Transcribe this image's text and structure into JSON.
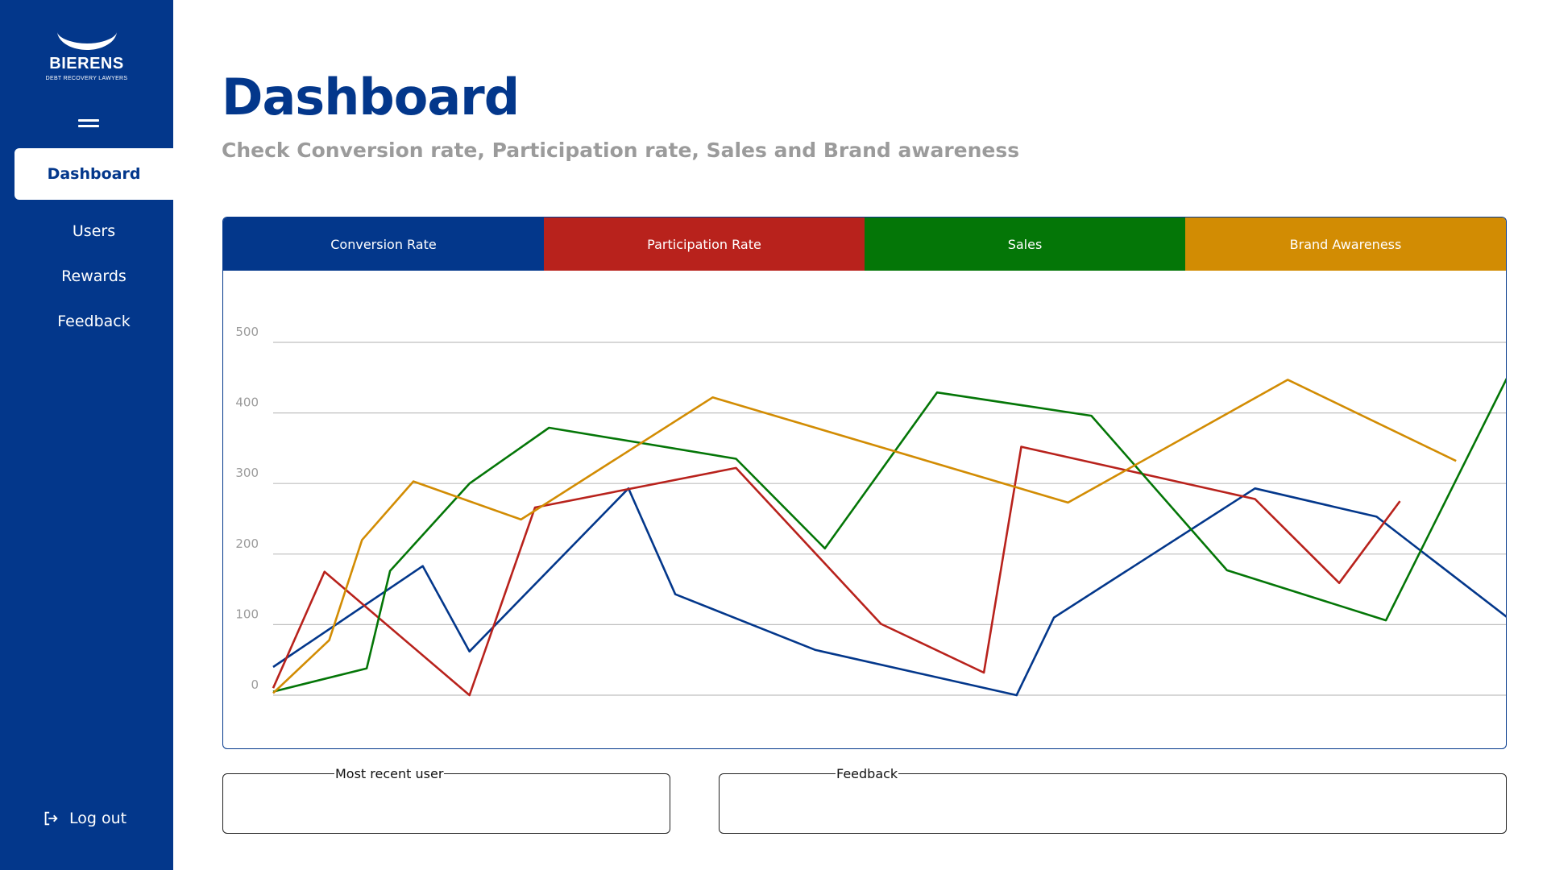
{
  "brand": {
    "name": "BIERENS",
    "tagline": "DEBT RECOVERY LAWYERS"
  },
  "sidebar": {
    "items": [
      {
        "label": "Dashboard",
        "active": true
      },
      {
        "label": "Users"
      },
      {
        "label": "Rewards"
      },
      {
        "label": "Feedback"
      }
    ],
    "logout_label": "Log out"
  },
  "header": {
    "title": "Dashboard",
    "subtitle": "Check Conversion rate, Participation rate, Sales and Brand awareness"
  },
  "tabs": [
    {
      "label": "Conversion Rate",
      "color": "#03378b"
    },
    {
      "label": "Participation Rate",
      "color": "#b8221c"
    },
    {
      "label": "Sales",
      "color": "#047607"
    },
    {
      "label": "Brand Awareness",
      "color": "#d28c03"
    }
  ],
  "colors": {
    "primary": "#03378b",
    "gridline": "#bfbfbf",
    "tick_text": "#9b9b9b"
  },
  "chart_data": {
    "type": "line",
    "y_ticks": [
      "500",
      "400",
      "300",
      "200",
      "100",
      "0"
    ],
    "ylim": [
      0,
      500
    ],
    "grid": true,
    "x": [
      0,
      1,
      2,
      3,
      4,
      5,
      6,
      7,
      8,
      9,
      10,
      11,
      12,
      13,
      14,
      15,
      16,
      17,
      18,
      19,
      20,
      21,
      22
    ],
    "series": [
      {
        "color": "#03378b",
        "points": [
          [
            0,
            40
          ],
          [
            3.2,
            183
          ],
          [
            4.2,
            62
          ],
          [
            7.6,
            293
          ],
          [
            8.6,
            143
          ],
          [
            11.6,
            64
          ],
          [
            15.9,
            0
          ],
          [
            16.7,
            110
          ],
          [
            21.0,
            293
          ],
          [
            23.6,
            253
          ],
          [
            26.4,
            110
          ]
        ]
      },
      {
        "color": "#b8221c",
        "points": [
          [
            0,
            10
          ],
          [
            1.1,
            175
          ],
          [
            4.2,
            0
          ],
          [
            5.6,
            266
          ],
          [
            9.9,
            322
          ],
          [
            13.0,
            101
          ],
          [
            15.2,
            32
          ],
          [
            16.0,
            352
          ],
          [
            21.0,
            278
          ],
          [
            22.8,
            159
          ],
          [
            24.1,
            275
          ]
        ]
      },
      {
        "color": "#047607",
        "points": [
          [
            0,
            5
          ],
          [
            2.0,
            38
          ],
          [
            2.5,
            176
          ],
          [
            4.2,
            300
          ],
          [
            5.9,
            379
          ],
          [
            9.9,
            335
          ],
          [
            11.8,
            208
          ],
          [
            14.2,
            429
          ],
          [
            17.5,
            396
          ],
          [
            20.4,
            177
          ],
          [
            23.8,
            106
          ],
          [
            26.4,
            451
          ]
        ]
      },
      {
        "color": "#d28c03",
        "points": [
          [
            0,
            3
          ],
          [
            1.2,
            78
          ],
          [
            1.9,
            220
          ],
          [
            3.0,
            303
          ],
          [
            5.3,
            249
          ],
          [
            9.4,
            422
          ],
          [
            17.0,
            273
          ],
          [
            21.7,
            447
          ],
          [
            25.3,
            332
          ]
        ]
      }
    ]
  },
  "panels": {
    "recent_user_label": "Most recent user",
    "feedback_label": "Feedback"
  }
}
